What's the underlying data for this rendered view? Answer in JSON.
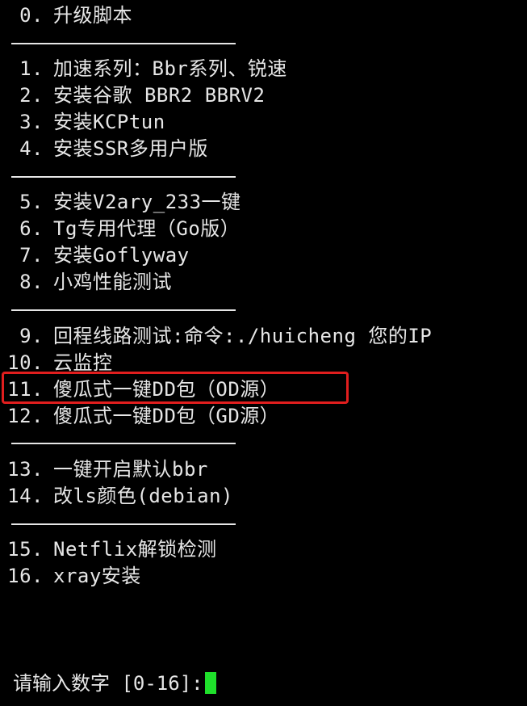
{
  "terminal": {
    "items": [
      {
        "num": "0.",
        "label": "升级脚本"
      },
      {
        "num": "1.",
        "label": "加速系列：Bbr系列、锐速"
      },
      {
        "num": "2.",
        "label": "安装谷歌 BBR2 BBRV2"
      },
      {
        "num": "3.",
        "label": "安装KCPtun"
      },
      {
        "num": "4.",
        "label": "安装SSR多用户版"
      },
      {
        "num": "5.",
        "label": "安装V2ary_233一键"
      },
      {
        "num": "6.",
        "label": "Tg专用代理（Go版）"
      },
      {
        "num": "7.",
        "label": "安装Goflyway"
      },
      {
        "num": "8.",
        "label": "小鸡性能测试"
      },
      {
        "num": "9.",
        "label": "回程线路测试:命令:./huicheng 您的IP"
      },
      {
        "num": "10.",
        "label": "云监控"
      },
      {
        "num": "11.",
        "label": "傻瓜式一键DD包（OD源）"
      },
      {
        "num": "12.",
        "label": "傻瓜式一键DD包（GD源）"
      },
      {
        "num": "13.",
        "label": "一键开启默认bbr"
      },
      {
        "num": "14.",
        "label": "改ls颜色(debian)"
      },
      {
        "num": "15.",
        "label": "Netflix解锁检测"
      },
      {
        "num": "16.",
        "label": "xray安装"
      }
    ],
    "prompt": "请输入数字 [0-16]:",
    "highlight_color": "#e11e1e",
    "cursor_color": "#1fe02b",
    "background_color": "#000000"
  }
}
